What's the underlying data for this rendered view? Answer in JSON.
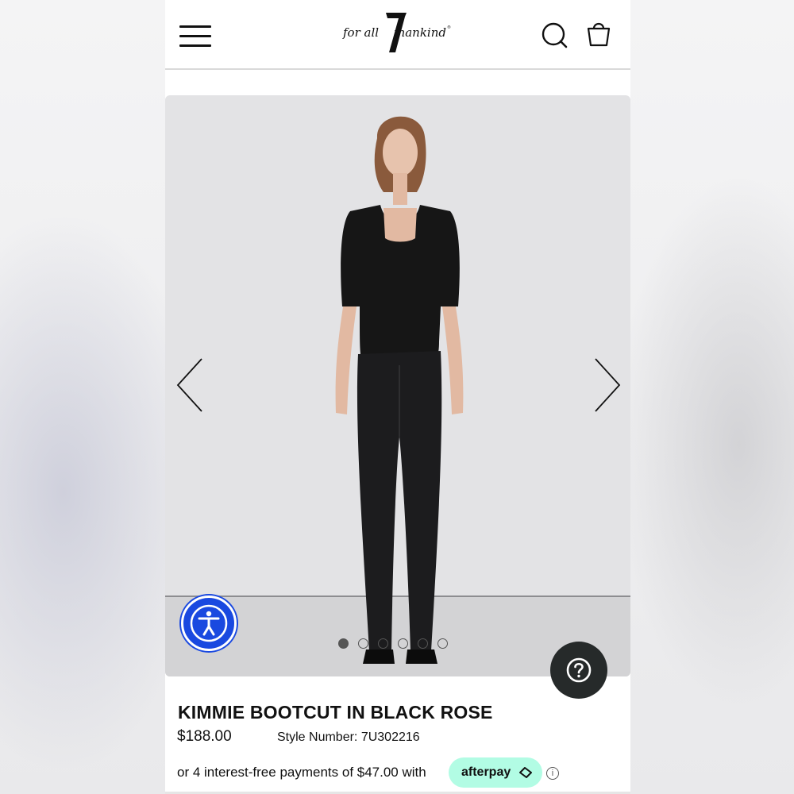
{
  "brand": {
    "logo_text": "for all 7 mankind",
    "logo_icon": "seven-mankind-logo"
  },
  "header": {
    "menu_icon": "hamburger-menu-icon",
    "search_icon": "search-icon",
    "bag_icon": "shopping-bag-icon"
  },
  "carousel": {
    "prev_icon": "chevron-left-icon",
    "next_icon": "chevron-right-icon",
    "image_count": 6,
    "active_index": 0
  },
  "accessibility_button": {
    "icon": "accessibility-person-icon"
  },
  "help_button": {
    "icon": "question-mark-icon"
  },
  "product": {
    "title": "KIMMIE BOOTCUT IN BLACK ROSE",
    "price": "$188.00",
    "style_label": "Style Number: 7U302216",
    "installments_text": "or 4 interest-free payments of $47.00 with",
    "afterpay_label": "afterpay",
    "info_icon": "info-icon"
  },
  "colors": {
    "accessibility_blue": "#1a49e0",
    "afterpay_mint": "#b2fce4",
    "help_dark": "#262a2a"
  }
}
